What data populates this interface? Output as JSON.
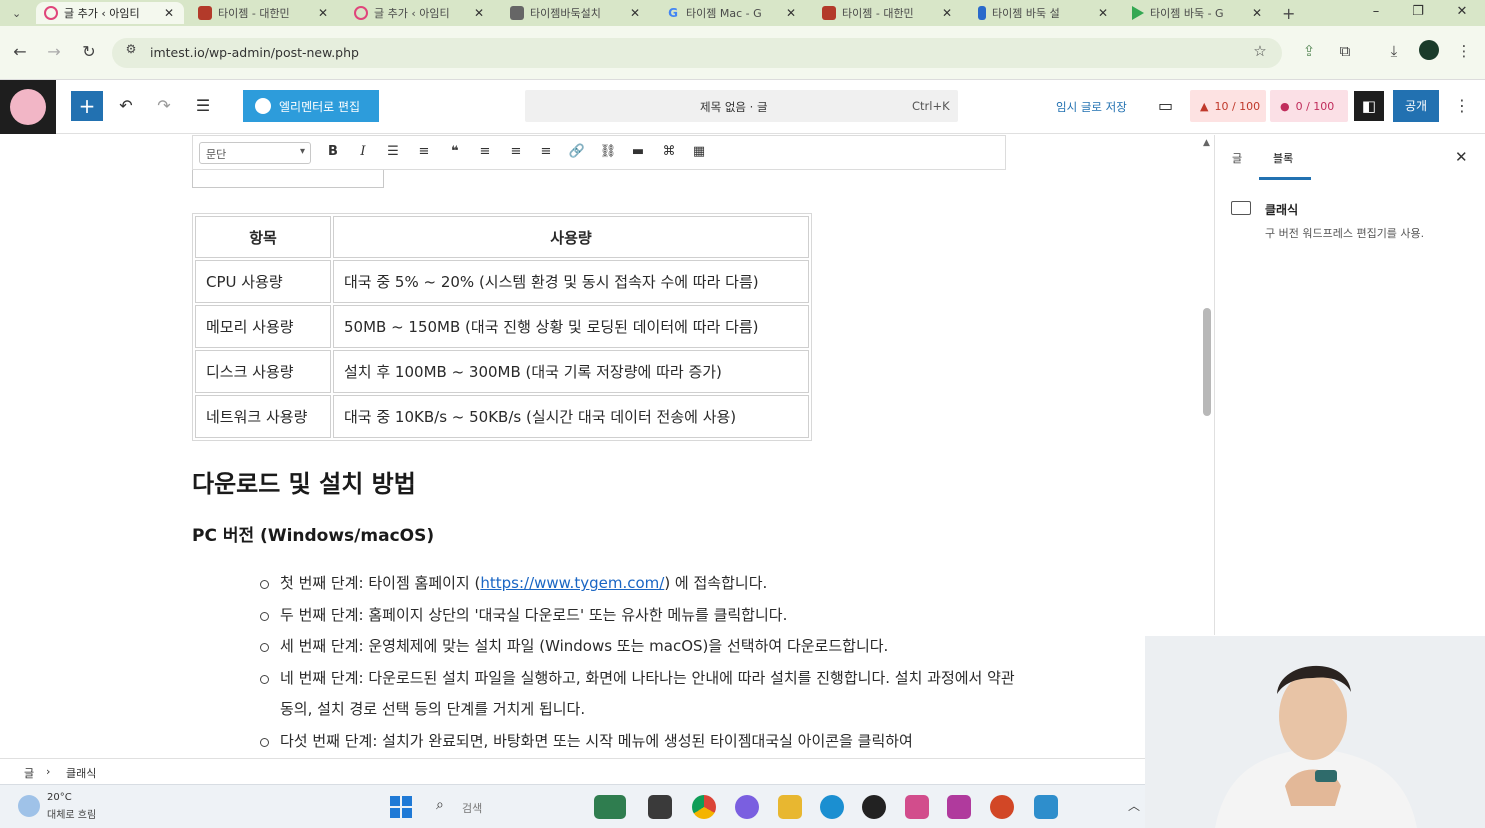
{
  "browser": {
    "tabs": [
      {
        "label": "글 추가 ‹ 아임티",
        "active": true,
        "icon": "wordpress-icon",
        "color": "#e0457b"
      },
      {
        "label": "타이젬 - 대한민",
        "active": false,
        "icon": "tygem-icon",
        "color": "#b33a2a"
      },
      {
        "label": "글 추가 ‹ 아임티",
        "active": false,
        "icon": "wordpress-icon",
        "color": "#e0457b"
      },
      {
        "label": "타이젬바둑설치",
        "active": false,
        "icon": "page-icon",
        "color": "#555555"
      },
      {
        "label": "타이젬 Mac - G",
        "active": false,
        "icon": "google-icon",
        "color": "#4285f4"
      },
      {
        "label": "타이젬 - 대한민",
        "active": false,
        "icon": "tygem-icon",
        "color": "#b33a2a"
      },
      {
        "label": "타이젬 바둑 설",
        "active": false,
        "icon": "bookmark-icon",
        "color": "#2a6acb"
      },
      {
        "label": "타이젬 바둑 - G",
        "active": false,
        "icon": "play-store-icon",
        "color": "#34a853"
      }
    ],
    "new_tab": "+",
    "url": "imtest.io/wp-admin/post-new.php"
  },
  "wp": {
    "elementor_label": "엘리멘터로 편집",
    "command_title": "제목 없음 · 글",
    "command_shortcut": "Ctrl+K",
    "save_draft": "임시 글로 저장",
    "score1": "10 / 100",
    "score2": "0 / 100",
    "publish": "공개"
  },
  "toolbar": {
    "format_value": "문단"
  },
  "table": {
    "headers": [
      "항목",
      "사용량"
    ],
    "rows": [
      [
        "CPU 사용량",
        "대국 중 5% ~ 20% (시스템 환경 및 동시 접속자 수에 따라 다름)"
      ],
      [
        "메모리 사용량",
        "50MB ~ 150MB (대국 진행 상황 및 로딩된 데이터에 따라 다름)"
      ],
      [
        "디스크 사용량",
        "설치 후 100MB ~ 300MB (대국 기록 저장량에 따라 증가)"
      ],
      [
        "네트워크 사용량",
        "대국 중 10KB/s ~ 50KB/s (실시간 대국 데이터 전송에 사용)"
      ]
    ]
  },
  "content": {
    "heading_download": "다운로드 및 설치 방법",
    "heading_pc": "PC 버전 (Windows/macOS)",
    "step1_pre": "첫 번째 단계: 타이젬 홈페이지 (",
    "step1_link": "https://www.tygem.com/",
    "step1_post": ") 에 접속합니다.",
    "step2": "두 번째 단계: 홈페이지 상단의 '대국실 다운로드' 또는 유사한 메뉴를 클릭합니다.",
    "step3": "세 번째 단계: 운영체제에 맞는 설치 파일 (Windows 또는 macOS)을 선택하여 다운로드합니다.",
    "step4": "네 번째 단계: 다운로드된 설치 파일을 실행하고, 화면에 나타나는 안내에 따라 설치를 진행합니다. 설치 과정에서 약관 동의, 설치 경로 선택 등의 단계를 거치게 됩니다.",
    "step5": "다섯 번째 단계: 설치가 완료되면, 바탕화면 또는 시작 메뉴에 생성된 타이젬대국실 아이콘을 클릭하여"
  },
  "sidebar": {
    "tab_post": "글",
    "tab_block": "블록",
    "block_name": "클래식",
    "block_desc": "구 버전 워드프레스 편집기를 사용."
  },
  "breadcrumb": {
    "root": "글",
    "separator": "›",
    "current": "클래식"
  },
  "taskbar": {
    "temperature": "20°C",
    "weather": "대체로 흐림",
    "search_placeholder": "검색",
    "apps": [
      {
        "icon": "photos-icon",
        "color": "#2f7d4f"
      },
      {
        "icon": "file-explorer-dark-icon",
        "color": "#3a3a3a"
      },
      {
        "icon": "chrome-icon",
        "color": "#3c9a50"
      },
      {
        "icon": "copilot-icon",
        "color": "#7a5fe0"
      },
      {
        "icon": "folder-icon",
        "color": "#e8b730"
      },
      {
        "icon": "edge-icon",
        "color": "#1b8fd1"
      },
      {
        "icon": "obs-icon",
        "color": "#222222"
      },
      {
        "icon": "snipping-tool-icon",
        "color": "#d24d8c"
      },
      {
        "icon": "onenote-icon",
        "color": "#b03a9d"
      },
      {
        "icon": "powerpoint-icon",
        "color": "#d24726"
      },
      {
        "icon": "notepad-icon",
        "color": "#2e8ecc"
      }
    ]
  },
  "colors": {
    "wp_blue": "#2271b1",
    "elementor_blue": "#2d9cdb",
    "link": "#1a66c4"
  }
}
